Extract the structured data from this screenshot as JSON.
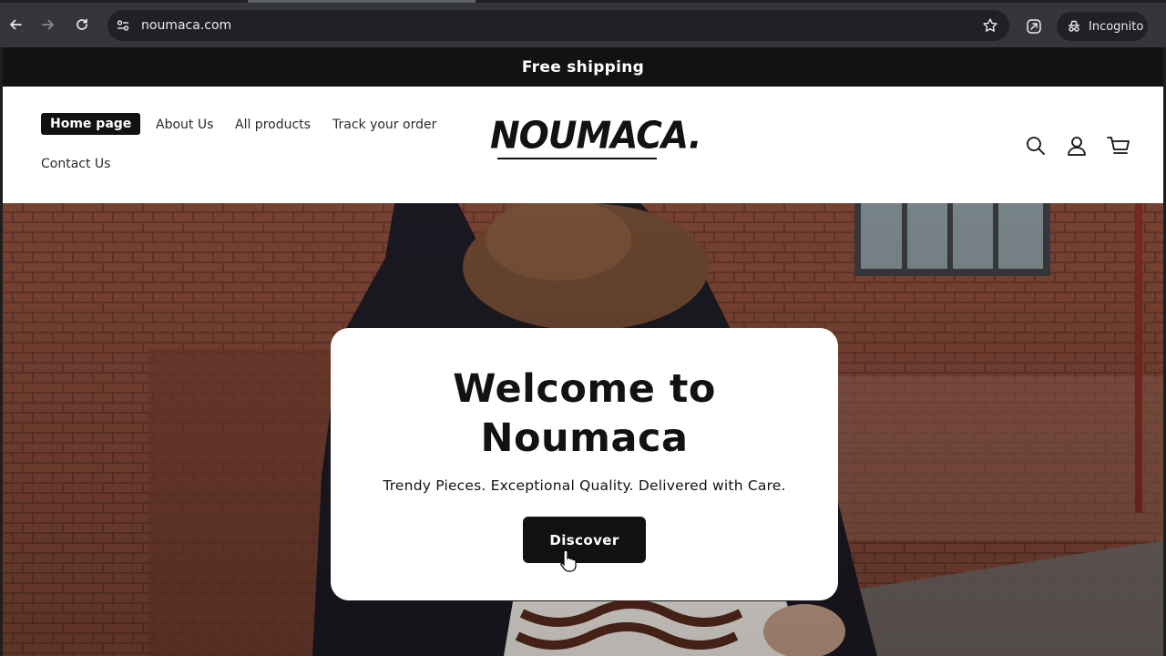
{
  "browser": {
    "url": "noumaca.com",
    "incognito_label": "Incognito"
  },
  "announcement": "Free shipping",
  "header": {
    "nav": [
      {
        "label": "Home page",
        "active": true
      },
      {
        "label": "About Us"
      },
      {
        "label": "All products"
      },
      {
        "label": "Track your order"
      },
      {
        "label": "Contact Us"
      }
    ],
    "logo": "NOUMACA."
  },
  "hero": {
    "title_line1": "Welcome to",
    "title_line2": "Noumaca",
    "tagline": "Trendy Pieces. Exceptional Quality. Delivered with Care.",
    "cta": "Discover"
  },
  "colors": {
    "announcement_bg": "#121212",
    "button_bg": "#121212",
    "chrome_bg": "#35363a"
  }
}
